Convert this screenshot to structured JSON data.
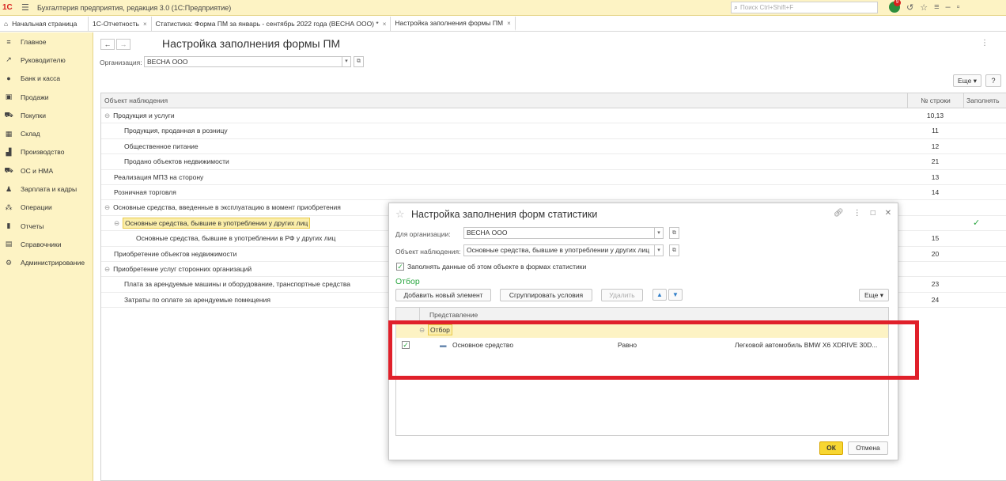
{
  "titlebar": {
    "logo": "1С",
    "app_title": "Бухгалтерия предприятия, редакция 3.0  (1С:Предприятие)",
    "search_placeholder": "Поиск Ctrl+Shift+F",
    "notifications_count": "9"
  },
  "tabs": [
    {
      "label": "Начальная страница"
    },
    {
      "label": "1С-Отчетность"
    },
    {
      "label": "Статистика: Форма ПМ за январь - сентябрь 2022 года (ВЕСНА ООО) *"
    },
    {
      "label": "Настройка заполнения формы ПМ"
    }
  ],
  "sidebar": {
    "items": [
      {
        "label": "Главное",
        "icon": "≡"
      },
      {
        "label": "Руководителю",
        "icon": "↗"
      },
      {
        "label": "Банк и касса",
        "icon": "●"
      },
      {
        "label": "Продажи",
        "icon": "▣"
      },
      {
        "label": "Покупки",
        "icon": "⛟"
      },
      {
        "label": "Склад",
        "icon": "▦"
      },
      {
        "label": "Производство",
        "icon": "▟"
      },
      {
        "label": "ОС и НМА",
        "icon": "⛟"
      },
      {
        "label": "Зарплата и кадры",
        "icon": "♟"
      },
      {
        "label": "Операции",
        "icon": "⁂"
      },
      {
        "label": "Отчеты",
        "icon": "▮"
      },
      {
        "label": "Справочники",
        "icon": "▤"
      },
      {
        "label": "Администрирование",
        "icon": "⚙"
      }
    ]
  },
  "main": {
    "title": "Настройка заполнения формы ПМ",
    "org_label": "Организация:",
    "org_value": "ВЕСНА ООО",
    "more_label": "Еще",
    "help_label": "?",
    "columns": {
      "object": "Объект наблюдения",
      "row_no": "№ строки",
      "fill": "Заполнять"
    },
    "rows": [
      {
        "label": "Продукция и услуги",
        "row": "10,13",
        "indent": 0,
        "toggle": true
      },
      {
        "label": "Продукция, проданная в розницу",
        "row": "11",
        "indent": 2
      },
      {
        "label": "Общественное питание",
        "row": "12",
        "indent": 2
      },
      {
        "label": "Продано объектов недвижимости",
        "row": "21",
        "indent": 2
      },
      {
        "label": "Реализация МПЗ на сторону",
        "row": "13",
        "indent": 1
      },
      {
        "label": "Розничная торговля",
        "row": "14",
        "indent": 1
      },
      {
        "label": "Основные средства, введенные в эксплуатацию в момент приобретения",
        "row": "",
        "indent": 0,
        "toggle": true
      },
      {
        "label": "Основные средства, бывшие в употреблении у других лиц",
        "row": "",
        "indent": 1,
        "toggle": true,
        "selected": true,
        "checked": true
      },
      {
        "label": "Основные средства, бывшие в употреблении в РФ у других лиц",
        "row": "15",
        "indent": 3
      },
      {
        "label": "Приобретение объектов недвижимости",
        "row": "20",
        "indent": 1
      },
      {
        "label": "Приобретение услуг сторонних организаций",
        "row": "",
        "indent": 0,
        "toggle": true
      },
      {
        "label": "Плата за арендуемые машины и оборудование, транспортные средства",
        "row": "23",
        "indent": 2
      },
      {
        "label": "Затраты по оплате за арендуемые помещения",
        "row": "24",
        "indent": 2
      }
    ]
  },
  "dialog": {
    "title": "Настройка заполнения форм статистики",
    "org_label": "Для организации:",
    "org_value": "ВЕСНА ООО",
    "object_label": "Объект наблюдения:",
    "object_value": "Основные средства, бывшие в употреблении у других лиц",
    "fill_checkbox_label": "Заполнять данные об этом объекте в формах статистики",
    "section_title": "Отбор",
    "add_btn": "Добавить новый элемент",
    "group_btn": "Сгруппировать условия",
    "delete_btn": "Удалить",
    "more_btn": "Еще",
    "column_header": "Представление",
    "group_row": "Отбор",
    "condition": {
      "field": "Основное средство",
      "comparison": "Равно",
      "value": "Легковой автомобиль  BMW X6  XDRIVE 30D..."
    },
    "ok_btn": "ОК",
    "cancel_btn": "Отмена"
  },
  "colors": {
    "brand_yellow": "#fdf3c4",
    "accent_green": "#2aa640",
    "highlight_red": "#e0202a",
    "ok_yellow": "#f7d632"
  }
}
